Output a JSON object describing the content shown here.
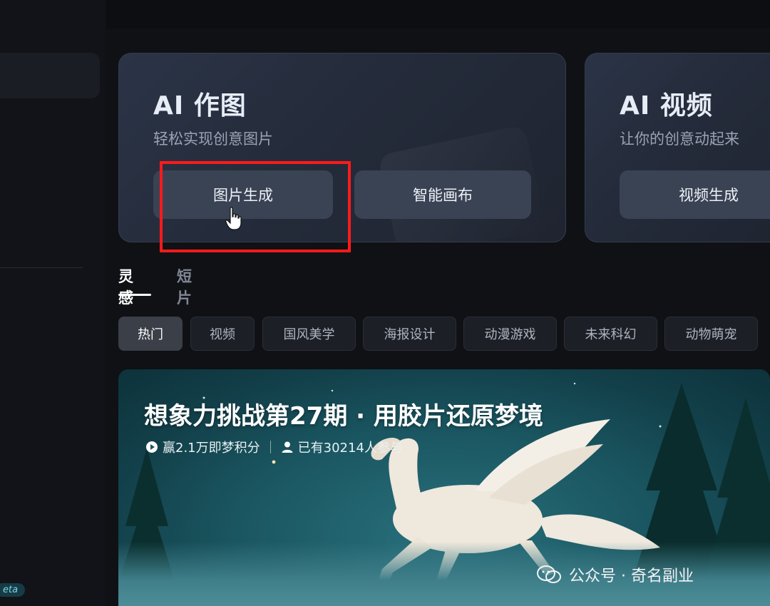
{
  "cards": [
    {
      "title": "AI 作图",
      "subtitle": "轻松实现创意图片",
      "buttons": [
        "图片生成",
        "智能画布"
      ]
    },
    {
      "title": "AI 视频",
      "subtitle": "让你的创意动起来",
      "buttons": [
        "视频生成"
      ]
    }
  ],
  "tabs": [
    "灵感",
    "短片"
  ],
  "chips": [
    "热门",
    "视频",
    "国风美学",
    "海报设计",
    "动漫游戏",
    "未来科幻",
    "动物萌宠"
  ],
  "banner": {
    "title": "想象力挑战第27期 · 用胶片还原梦境",
    "prize": "赢2.1万即梦积分",
    "participants": "已有30214人参与"
  },
  "sidebar": {
    "badge": "eta"
  },
  "watermark": "公众号 · 奇名副业",
  "colors": {
    "highlight": "#ff1a1a",
    "accent_card": "#2b3447"
  },
  "icons": [
    "play-circle-icon",
    "user-icon",
    "cursor-hand-icon",
    "wechat-icon"
  ]
}
